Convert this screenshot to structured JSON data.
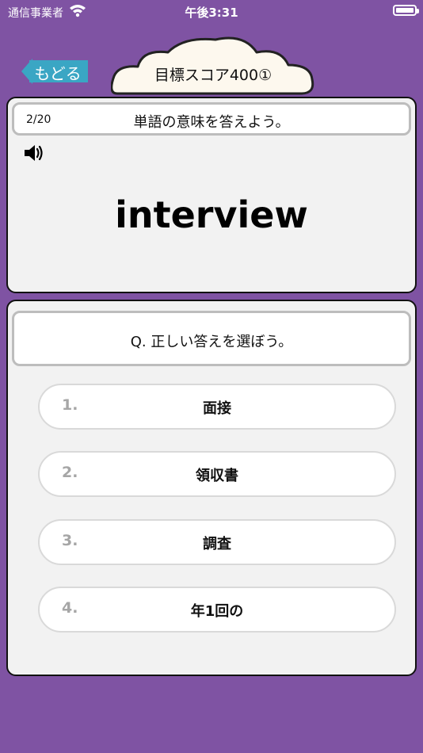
{
  "status_bar": {
    "carrier": "通信事業者",
    "time": "午後3:31"
  },
  "nav": {
    "back_label": "もどる",
    "title": "目標スコア400①",
    "back_color": "#3aa6c4"
  },
  "word_card": {
    "progress": "2/20",
    "instruction": "単語の意味を答えよう。",
    "word": "interview"
  },
  "answer_card": {
    "question": "Q. 正しい答えを選ぼう。",
    "options": [
      {
        "num": "1.",
        "label": "面接"
      },
      {
        "num": "2.",
        "label": "領収書"
      },
      {
        "num": "3.",
        "label": "調査"
      },
      {
        "num": "4.",
        "label": "年1回の"
      }
    ]
  },
  "colors": {
    "background": "#7f53a3",
    "card": "#f2f2f2",
    "cloud_fill": "#fdf8ee"
  }
}
